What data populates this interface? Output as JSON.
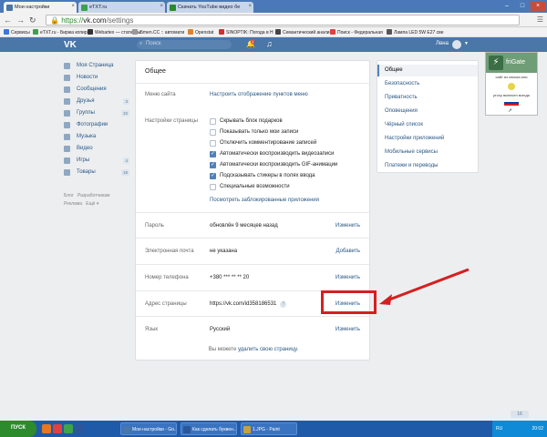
{
  "browser": {
    "tabs": [
      {
        "title": "Мои настройки",
        "active": true,
        "color": "#4a76a8"
      },
      {
        "title": "eTXT.ru",
        "active": false,
        "color": "#3aa34a"
      },
      {
        "title": "Скачать YouTube видео бе",
        "active": false,
        "color": "#2a8a2a"
      }
    ],
    "url_scheme": "https://",
    "url_host": "vk.com",
    "url_path": "/settings",
    "bookmarks": [
      {
        "label": "Сервисы",
        "color": "#3c78d8"
      },
      {
        "label": "eTXT.ru - Биржа копир",
        "color": "#3aa34a"
      },
      {
        "label": "Webartex — статейны",
        "color": "#333333"
      },
      {
        "label": "i5men.CC :: автомати",
        "color": "#999999"
      },
      {
        "label": "Openstat",
        "color": "#e08030"
      },
      {
        "label": "SINOPTIK: Погода в Н",
        "color": "#d03030"
      },
      {
        "label": "Семантический анали",
        "color": "#444444"
      },
      {
        "label": "Поиск - Федеральная",
        "color": "#e04040"
      },
      {
        "label": "Лампа LED 5W E27 све",
        "color": "#555555"
      }
    ]
  },
  "vk": {
    "logo": "VK",
    "search_placeholder": "Поиск",
    "notif_count": "1",
    "user_name": "Лена",
    "left_menu": [
      {
        "label": "Моя Страница",
        "count": ""
      },
      {
        "label": "Новости",
        "count": ""
      },
      {
        "label": "Сообщения",
        "count": ""
      },
      {
        "label": "Друзья",
        "count": "3"
      },
      {
        "label": "Группы",
        "count": "10"
      },
      {
        "label": "Фотографии",
        "count": ""
      },
      {
        "label": "Музыка",
        "count": ""
      },
      {
        "label": "Видео",
        "count": ""
      },
      {
        "label": "Игры",
        "count": "4"
      },
      {
        "label": "Товары",
        "count": "18"
      }
    ],
    "left_footer": {
      "blog": "Блог",
      "developers": "Разработчикам",
      "ads": "Реклама",
      "more": "Ещё"
    },
    "settings": {
      "title": "Общее",
      "menu_label": "Меню сайта",
      "menu_value": "Настроить отображение пунктов меню",
      "page_settings_label": "Настройки страницы",
      "checkboxes": [
        {
          "label": "Скрывать блок подарков",
          "checked": false
        },
        {
          "label": "Показывать только мои записи",
          "checked": false
        },
        {
          "label": "Отключить комментирование записей",
          "checked": false
        },
        {
          "label": "Автоматически воспроизводить видеозаписи",
          "checked": true
        },
        {
          "label": "Автоматически воспроизводить GIF-анимации",
          "checked": true
        },
        {
          "label": "Подсказывать стикеры в полях ввода",
          "checked": true
        },
        {
          "label": "Специальные возможности",
          "checked": false
        }
      ],
      "blocked_apps_link": "Посмотреть заблокированные приложения",
      "rows": [
        {
          "label": "Пароль",
          "value": "обновлён 9 месяцев назад",
          "action": "Изменить",
          "help": false
        },
        {
          "label": "Электронная почта",
          "value": "не указана",
          "action": "Добавить",
          "help": false
        },
        {
          "label": "Номер телефона",
          "value": "+380 *** ** ** 20",
          "action": "Изменить",
          "help": false
        },
        {
          "label": "Адрес страницы",
          "value": "https://vk.com/id358186531",
          "action": "Изменить",
          "help": true
        },
        {
          "label": "Язык",
          "value": "Русский",
          "action": "Изменить",
          "help": false
        }
      ],
      "delete_prefix": "Вы можете",
      "delete_link": "удалить свою страницу."
    },
    "right_nav": [
      {
        "label": "Общее",
        "active": true
      },
      {
        "label": "Безопасность",
        "active": false
      },
      {
        "label": "Приватность",
        "active": false
      },
      {
        "label": "Оповещения",
        "active": false
      },
      {
        "label": "Чёрный список",
        "active": false
      },
      {
        "label": "Настройки приложений",
        "active": false
      },
      {
        "label": "Мобильные сервисы",
        "active": false
      },
      {
        "label": "Платежи и переводы",
        "active": false
      }
    ],
    "chat_count": "16"
  },
  "frigate": {
    "name": "friGate",
    "text1": "сайт из списка или",
    "text2": "proxy включен всегда"
  },
  "taskbar": {
    "start": "ПУСК",
    "items": [
      {
        "label": "Мои настройки - Go...",
        "color": "#4a76a8"
      },
      {
        "label": "Как сделать буквен...",
        "color": "#2b579a"
      },
      {
        "label": "1.JPG - Paint",
        "color": "#c8a040"
      }
    ],
    "lang": "RU",
    "time": "20:02"
  },
  "colors": {
    "vk_blue": "#4a76a8",
    "link": "#2a5885",
    "highlight": "#d42020"
  }
}
